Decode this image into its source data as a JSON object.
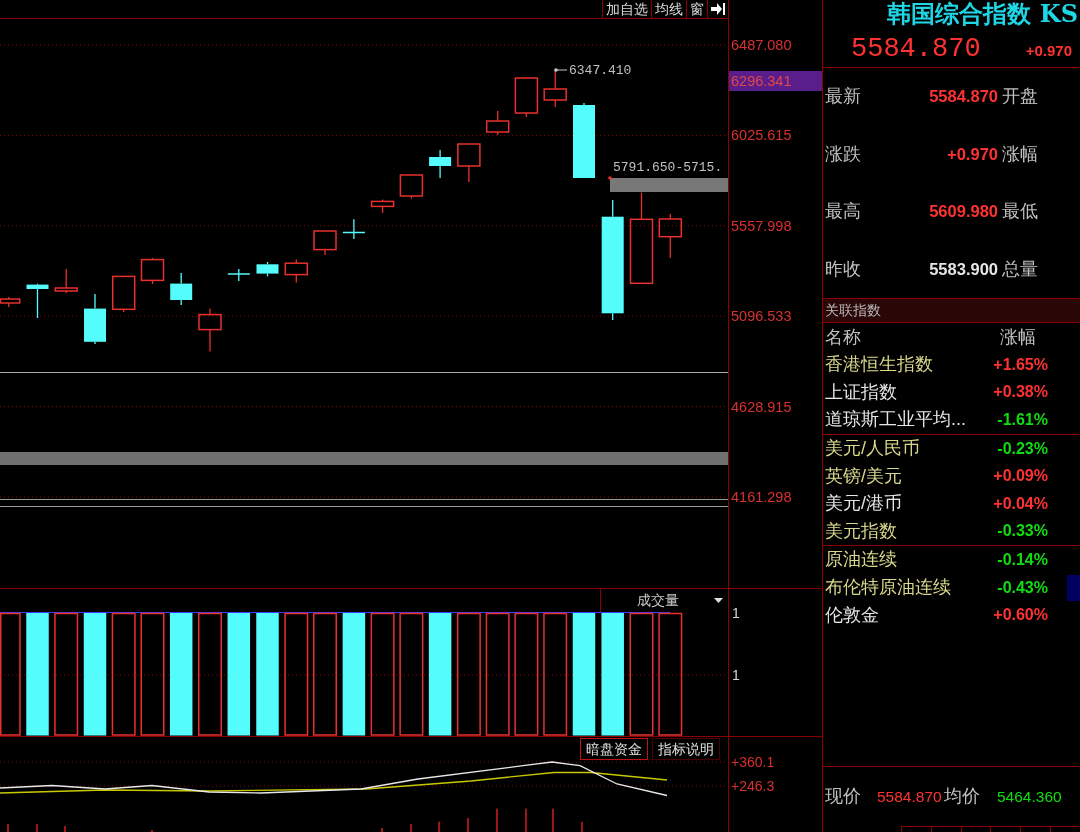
{
  "toolbar": {
    "buttons": [
      "加自选",
      "均线",
      "窗"
    ]
  },
  "price_chart": {
    "axis_labels": [
      "6487.080",
      "6025.615",
      "5557.998",
      "5096.533",
      "4628.915",
      "4161.298"
    ],
    "crosshair_price": "6296.341",
    "high_label": "6347.410",
    "gap_label": "5791.650-5715."
  },
  "volume_pane": {
    "indicator": "成交量",
    "axis_labels": [
      "1",
      "1"
    ]
  },
  "fund_pane": {
    "tabs": [
      {
        "label": "暗盘资金",
        "selected": true
      },
      {
        "label": "指标说明",
        "selected": false
      }
    ],
    "axis_labels": [
      "+360.1",
      "+246.3"
    ]
  },
  "quote": {
    "title": "韩国综合指数 KS",
    "price": "5584.870",
    "change": "+0.970",
    "color": "#ff3232",
    "rows": [
      {
        "label": "最新",
        "value": "5584.870",
        "color": "#ff3232",
        "label_2": "开盘"
      },
      {
        "label": "涨跌",
        "value": "+0.970",
        "color": "#ff3232",
        "label_2": "涨幅"
      },
      {
        "label": "最高",
        "value": "5609.980",
        "color": "#ff3232",
        "label_2": "最低"
      },
      {
        "label": "昨收",
        "value": "5583.900",
        "color": "#e6e6e6",
        "label_2": "总量"
      }
    ]
  },
  "related": {
    "title": "关联指数",
    "columns": [
      "名称",
      "涨幅"
    ],
    "groups": [
      {
        "items": [
          {
            "name": "香港恒生指数",
            "change": "+1.65%",
            "rising": true,
            "color": "#d8d88c",
            "selected": false
          },
          {
            "name": "上证指数",
            "change": "+0.38%",
            "rising": true,
            "color": "#e6e6e6",
            "selected": false
          },
          {
            "name": "道琼斯工业平均...",
            "change": "-1.61%",
            "rising": false,
            "color": "#e6e6e6",
            "selected": false
          }
        ]
      },
      {
        "items": [
          {
            "name": "美元/人民币",
            "change": "-0.23%",
            "rising": false,
            "color": "#d8d88c",
            "selected": false
          },
          {
            "name": "英镑/美元",
            "change": "+0.09%",
            "rising": true,
            "color": "#d8d88c",
            "selected": false
          },
          {
            "name": "美元/港币",
            "change": "+0.04%",
            "rising": true,
            "color": "#e6e6e6",
            "selected": false
          },
          {
            "name": "美元指数",
            "change": "-0.33%",
            "rising": false,
            "color": "#d8d88c",
            "selected": false
          }
        ]
      },
      {
        "items": [
          {
            "name": "原油连续",
            "change": "-0.14%",
            "rising": false,
            "color": "#d8d88c",
            "selected": false
          },
          {
            "name": "布伦特原油连续",
            "change": "-0.43%",
            "rising": false,
            "color": "#d8d88c",
            "selected": true
          },
          {
            "name": "伦敦金",
            "change": "+0.60%",
            "rising": true,
            "color": "#e6e6e6",
            "selected": false
          }
        ]
      }
    ]
  },
  "summary": [
    {
      "label": "现价",
      "value": "5584.870",
      "color": "#ff3232"
    },
    {
      "label": "均价",
      "value": "5464.360",
      "color": "#10dd10"
    }
  ]
}
